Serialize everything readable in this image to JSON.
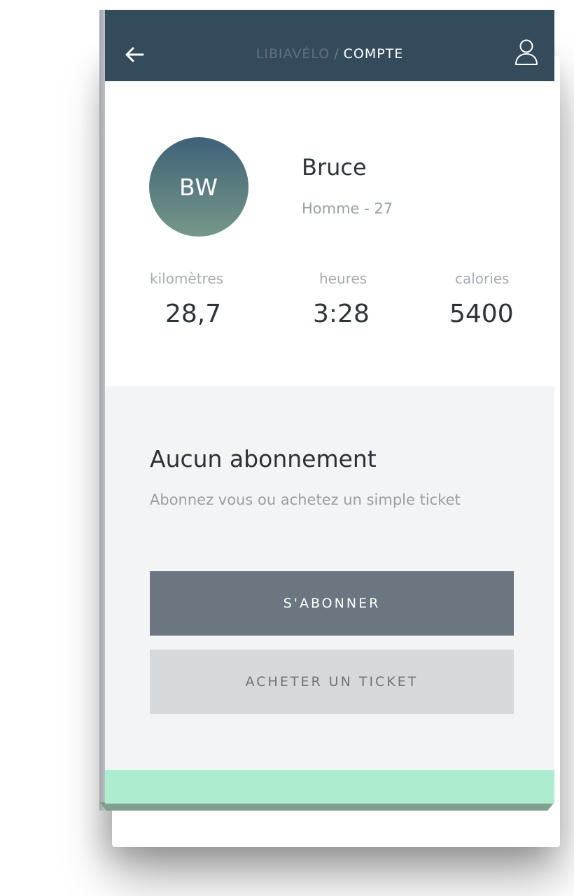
{
  "header": {
    "brand": "LIBIAVÉLO",
    "separator": "/",
    "page": "COMPTE",
    "back_icon": "arrow-left-icon",
    "profile_icon": "user-icon"
  },
  "profile": {
    "initials": "BW",
    "name": "Bruce",
    "details": "Homme - 27"
  },
  "stats": [
    {
      "label": "kilomètres",
      "value": "28,7"
    },
    {
      "label": "heures",
      "value": "3:28"
    },
    {
      "label": "calories",
      "value": "5400"
    }
  ],
  "subscription": {
    "title": "Aucun abonnement",
    "description": "Abonnez vous ou achetez un simple ticket",
    "subscribe_label": "S'ABONNER",
    "ticket_label": "ACHETER UN TICKET"
  },
  "colors": {
    "header_bg": "#334b5b",
    "primary_button": "#6b7680",
    "secondary_button": "#d6d9dc",
    "footer_accent": "#aeeccf"
  }
}
